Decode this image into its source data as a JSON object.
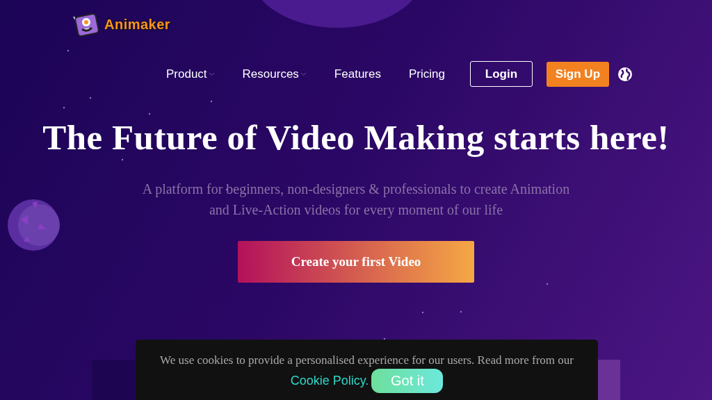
{
  "logo": {
    "text": "Animaker"
  },
  "nav": {
    "items": [
      {
        "label": "Product",
        "has_menu": true
      },
      {
        "label": "Resources",
        "has_menu": true
      },
      {
        "label": "Features",
        "has_menu": false
      },
      {
        "label": "Pricing",
        "has_menu": false
      }
    ],
    "login": "Login",
    "signup": "Sign Up"
  },
  "hero": {
    "title": "The Future of Video Making starts here!",
    "subtitle": "A platform for beginners, non-designers & professionals to create Animation and Live-Action videos for every moment of our life",
    "cta": "Create your first Video"
  },
  "cookie_banner": {
    "text": "We use cookies to provide a personalised experience for our users. Read more from our",
    "link": "Cookie Policy.",
    "button": "Got it"
  }
}
